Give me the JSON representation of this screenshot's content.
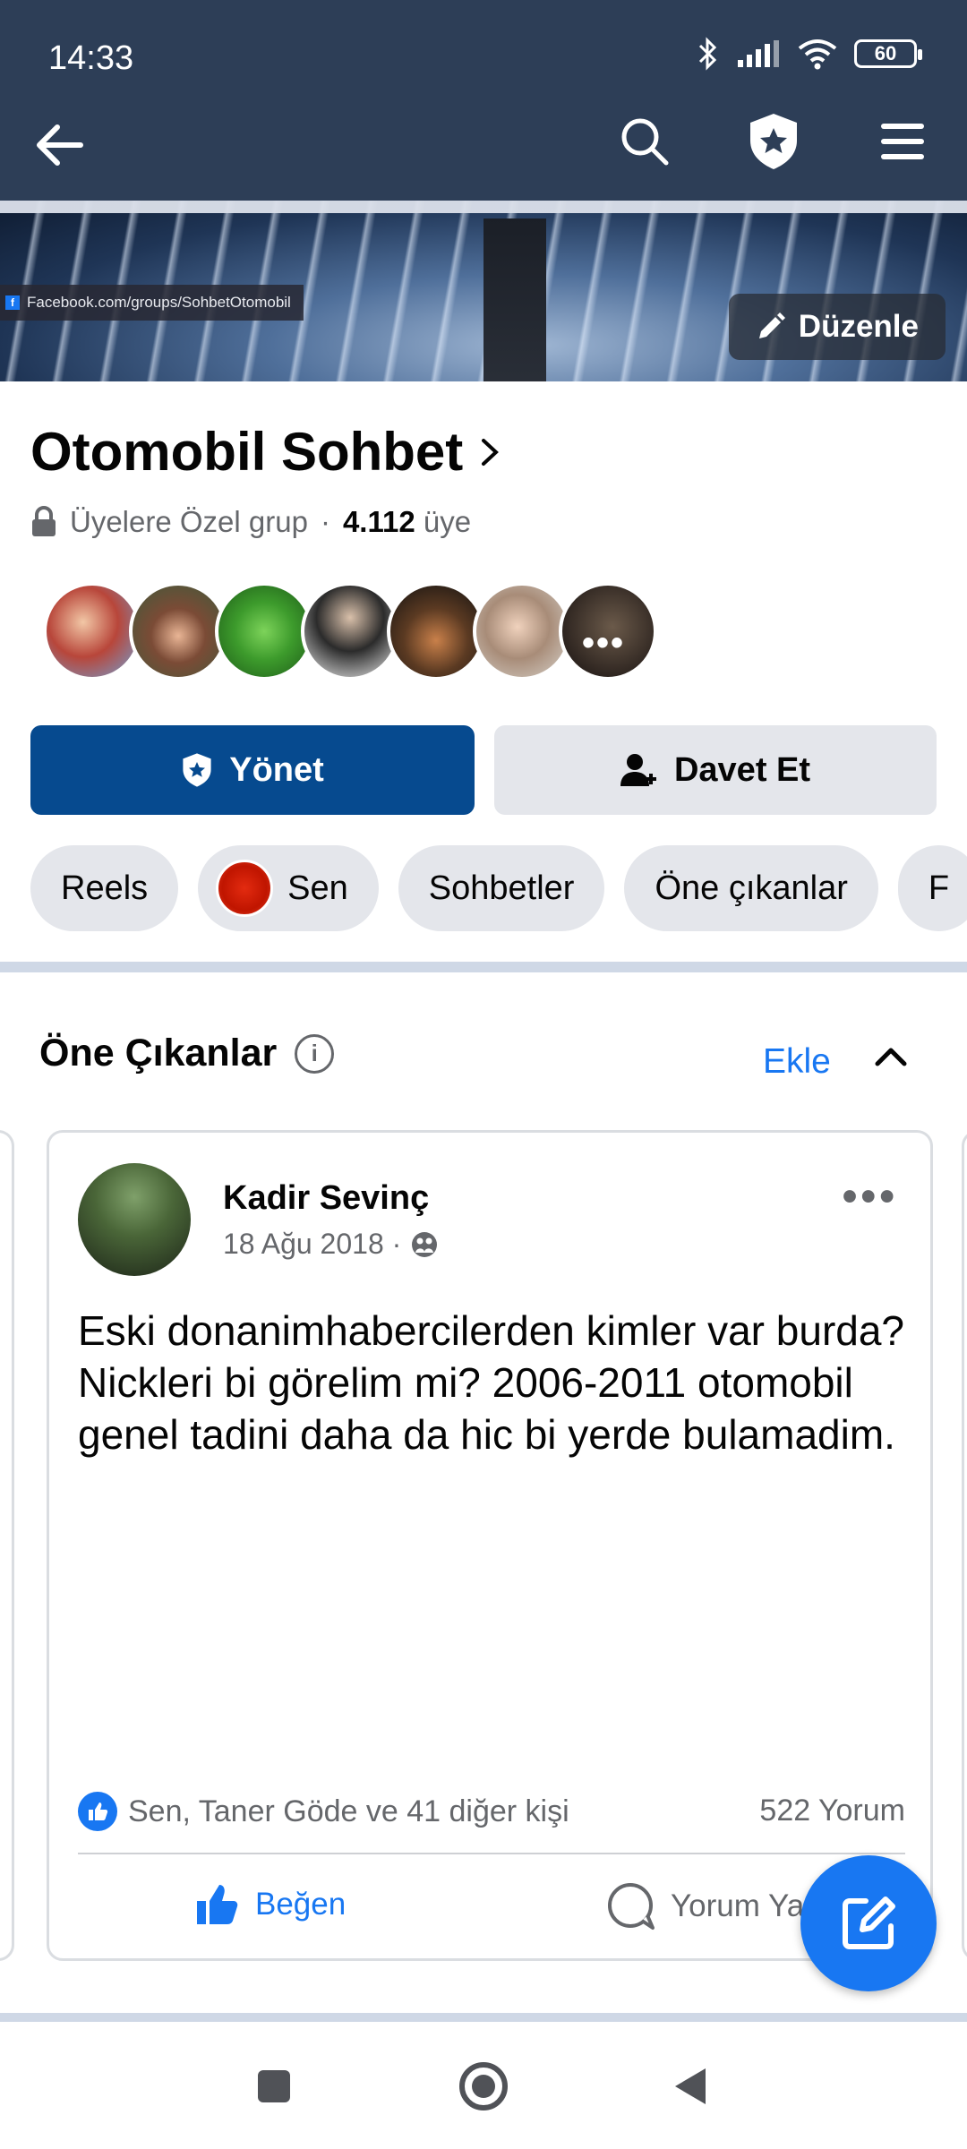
{
  "status_bar": {
    "time": "14:33",
    "battery": "60"
  },
  "cover": {
    "source_tag": "Facebook.com/groups/SohbetOtomobil",
    "edit_label": "Düzenle"
  },
  "group": {
    "name": "Otomobil Sohbet",
    "privacy": "Üyelere Özel grup",
    "separator": "·",
    "member_count": "4.112",
    "member_word": "üye"
  },
  "actions": {
    "manage_label": "Yönet",
    "invite_label": "Davet Et"
  },
  "tabs": [
    {
      "label": "Reels"
    },
    {
      "label": "Sen"
    },
    {
      "label": "Sohbetler"
    },
    {
      "label": "Öne çıkanlar"
    },
    {
      "label": "F"
    }
  ],
  "highlights": {
    "title": "Öne Çıkanlar",
    "add_label": "Ekle",
    "post": {
      "author": "Kadir Sevinç",
      "date": "18 Ağu 2018 ·",
      "text": "Eski donanimhabercilerden kimler var burda? Nickleri bi görelim mi? 2006-2011 otomobil genel tadini daha da hic bi yerde bulamadim.",
      "reactions": "Sen, Taner Göde ve 41 diğer kişi",
      "comments": "522 Yorum",
      "like_label": "Beğen",
      "comment_label": "Yorum Ya"
    }
  },
  "colors": {
    "header_bg": "#2d3e57",
    "accent": "#1877f2",
    "manage_bg": "#064a8f"
  }
}
